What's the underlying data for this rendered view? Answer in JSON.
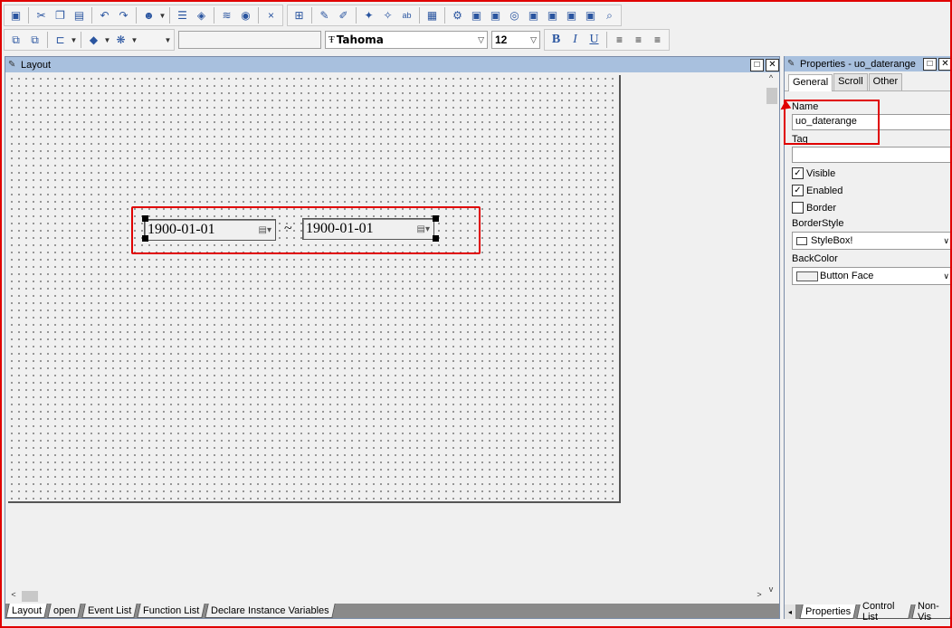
{
  "toolbar": {
    "font_name": "Tahoma",
    "font_size": "12",
    "bold_label": "B",
    "italic_label": "I",
    "underline_label": "U",
    "close_label": "×",
    "subscript_label": "ab"
  },
  "layout": {
    "title": "Layout",
    "date_start": "1900-01-01",
    "date_end": "1900-01-01",
    "separator": "~",
    "tabs": [
      "Layout",
      "open",
      "Event List",
      "Function List",
      "Declare Instance Variables"
    ]
  },
  "properties": {
    "title": "Properties - uo_daterange",
    "tabs": [
      "General",
      "Scroll",
      "Other"
    ],
    "name_label": "Name",
    "name_value": "uo_daterange",
    "tag_label": "Tag",
    "tag_value": "",
    "visible_label": "Visible",
    "visible_checked": true,
    "enabled_label": "Enabled",
    "enabled_checked": true,
    "border_label": "Border",
    "border_checked": false,
    "borderstyle_label": "BorderStyle",
    "borderstyle_value": "StyleBox!",
    "backcolor_label": "BackColor",
    "backcolor_value": "Button Face",
    "bottom_tabs": [
      "Properties",
      "Control List",
      "Non-Vis"
    ]
  },
  "colors": {
    "highlight": "#e00000",
    "title_bar": "#a8c0de"
  }
}
